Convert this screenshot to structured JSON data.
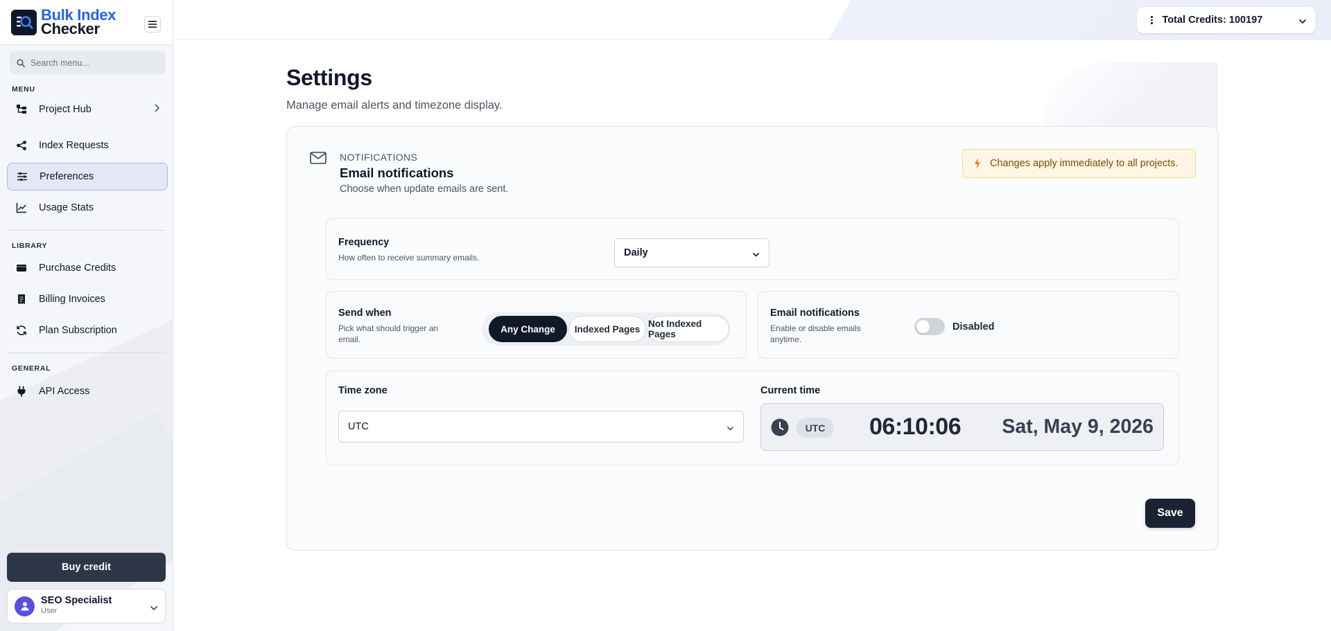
{
  "brand": {
    "line1": "Bulk Index",
    "line2": "Checker"
  },
  "search": {
    "placeholder": "Search menu..."
  },
  "sidebar": {
    "sections": [
      {
        "label": "MENU"
      },
      {
        "label": "LIBRARY"
      },
      {
        "label": "GENERAL"
      }
    ],
    "items": [
      {
        "label": "Project Hub",
        "icon": "hierarchy-icon"
      },
      {
        "label": "Index Requests",
        "icon": "share-nodes-icon"
      },
      {
        "label": "Preferences",
        "icon": "sliders-icon",
        "active": true
      },
      {
        "label": "Usage Stats",
        "icon": "line-chart-icon"
      },
      {
        "label": "Purchase Credits",
        "icon": "wallet-icon"
      },
      {
        "label": "Billing Invoices",
        "icon": "receipt-icon"
      },
      {
        "label": "Plan Subscription",
        "icon": "refresh-icon"
      },
      {
        "label": "API Access",
        "icon": "plug-icon"
      }
    ],
    "buy_label": "Buy credit",
    "user": {
      "name": "SEO Specialist",
      "role": "User"
    }
  },
  "topbar": {
    "credits_label": "Total Credits: 100197"
  },
  "page": {
    "title": "Settings",
    "subtitle": "Manage email alerts and timezone display."
  },
  "card": {
    "eyebrow": "NOTIFICATIONS",
    "title": "Email notifications",
    "description": "Choose when update emails are sent.",
    "notice": "Changes apply immediately to all projects.",
    "frequency": {
      "label": "Frequency",
      "help": "How often to receive summary emails.",
      "value": "Daily"
    },
    "send_when": {
      "label": "Send when",
      "help": "Pick what should trigger an email.",
      "options": [
        "Any Change",
        "Indexed Pages",
        "Not Indexed Pages"
      ],
      "selected": "Any Change"
    },
    "email_toggle": {
      "label": "Email notifications",
      "help": "Enable or disable emails anytime.",
      "state_label": "Disabled",
      "enabled": false
    },
    "timezone": {
      "label": "Time zone",
      "value": "UTC"
    },
    "current_time": {
      "label": "Current time",
      "zone": "UTC",
      "time": "06:10:06",
      "date": "Sat, May 9, 2026"
    },
    "save_label": "Save"
  },
  "colors": {
    "brand_blue": "#2563eb",
    "dark": "#111827",
    "active_nav_bg": "#e3e8f4",
    "notice_bg": "#fff7e3",
    "notice_icon": "#f97316",
    "avatar": "#5b4ee0"
  }
}
